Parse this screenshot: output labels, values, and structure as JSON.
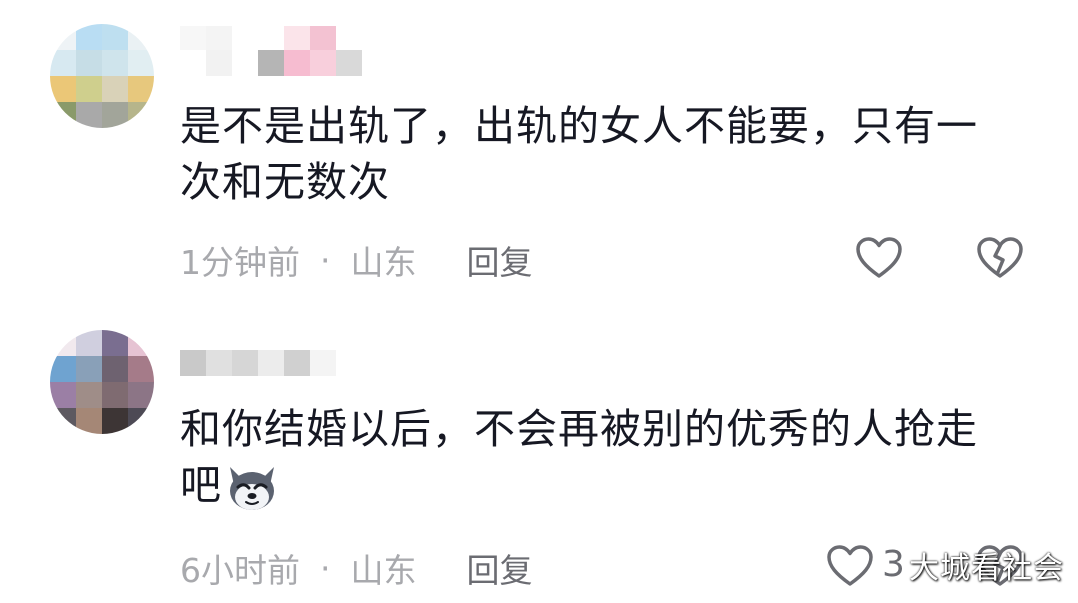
{
  "comments": [
    {
      "text": "是不是出轨了，出轨的女人不能要，只有一次和无数次",
      "time": "1分钟前",
      "separator": "·",
      "location": "山东",
      "reply_label": "回复",
      "like_count": ""
    },
    {
      "text": "和你结婚以后，不会再被别的优秀的人抢走吧",
      "emoji": "husky-dog-emoji",
      "time": "6小时前",
      "separator": "·",
      "location": "山东",
      "reply_label": "回复",
      "like_count": "3"
    }
  ],
  "watermark": "大城看社会",
  "icons": {
    "like": "heart-outline-icon",
    "dislike": "broken-heart-icon"
  },
  "colors": {
    "text": "#161823",
    "meta": "#a8a9ad",
    "icon": "#6b6c72"
  }
}
